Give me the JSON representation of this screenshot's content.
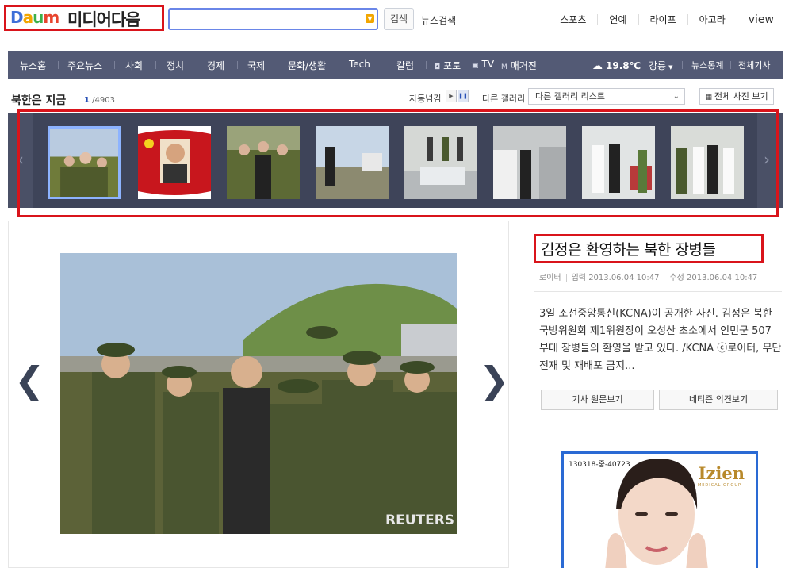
{
  "header": {
    "logo_letters": [
      "D",
      "a",
      "u",
      "m"
    ],
    "logo_sub": "미디어다음",
    "search_value": "",
    "search_button": "검색",
    "news_search_link": "뉴스검색",
    "top_links": [
      "스포츠",
      "연예",
      "라이프",
      "아고라",
      "view"
    ]
  },
  "nav": {
    "items": [
      "뉴스홈",
      "주요뉴스",
      "사회",
      "정치",
      "경제",
      "국제",
      "문화/생활",
      "Tech",
      "칼럼"
    ],
    "media": [
      "포토",
      "TV",
      "매거진"
    ],
    "weather_temp": "19.8℃",
    "weather_region": "강릉",
    "right": [
      "뉴스통계",
      "전체기사"
    ]
  },
  "gallery_bar": {
    "title": "북한은 지금",
    "current": "1",
    "total": "/4903",
    "autoplay_label": "자동넘김",
    "other_gallery_label": "다른 갤러리",
    "gallery_select_value": "다른 갤러리 리스트",
    "all_photos_button": "전체 사진 보기"
  },
  "article": {
    "title": "김정은 환영하는 북한 장병들",
    "source": "로이터",
    "input_time": "입력 2013.06.04 10:47",
    "edit_time": "수정 2013.06.04 10:47",
    "body": "3일 조선중앙통신(KCNA)이 공개한 사진. 김정은 북한 국방위원회 제1위원장이 오성산 초소에서 인민군 507 부대 장병들의 환영을 받고 있다. /KCNA ⓒ로이터, 무단전재 및 재배포 금지...",
    "btn_original": "기사 원문보기",
    "btn_netizen": "네티즌 의견보기",
    "watermark": "REUTERS"
  },
  "ad": {
    "code": "130318-중-40723",
    "brand": "Izien",
    "brand_sub": "GLOBAL MEDICAL GROUP"
  },
  "colors": {
    "nav_bg": "#535a75",
    "highlight": "#d9141b",
    "strip_bg": "#3e4459"
  }
}
